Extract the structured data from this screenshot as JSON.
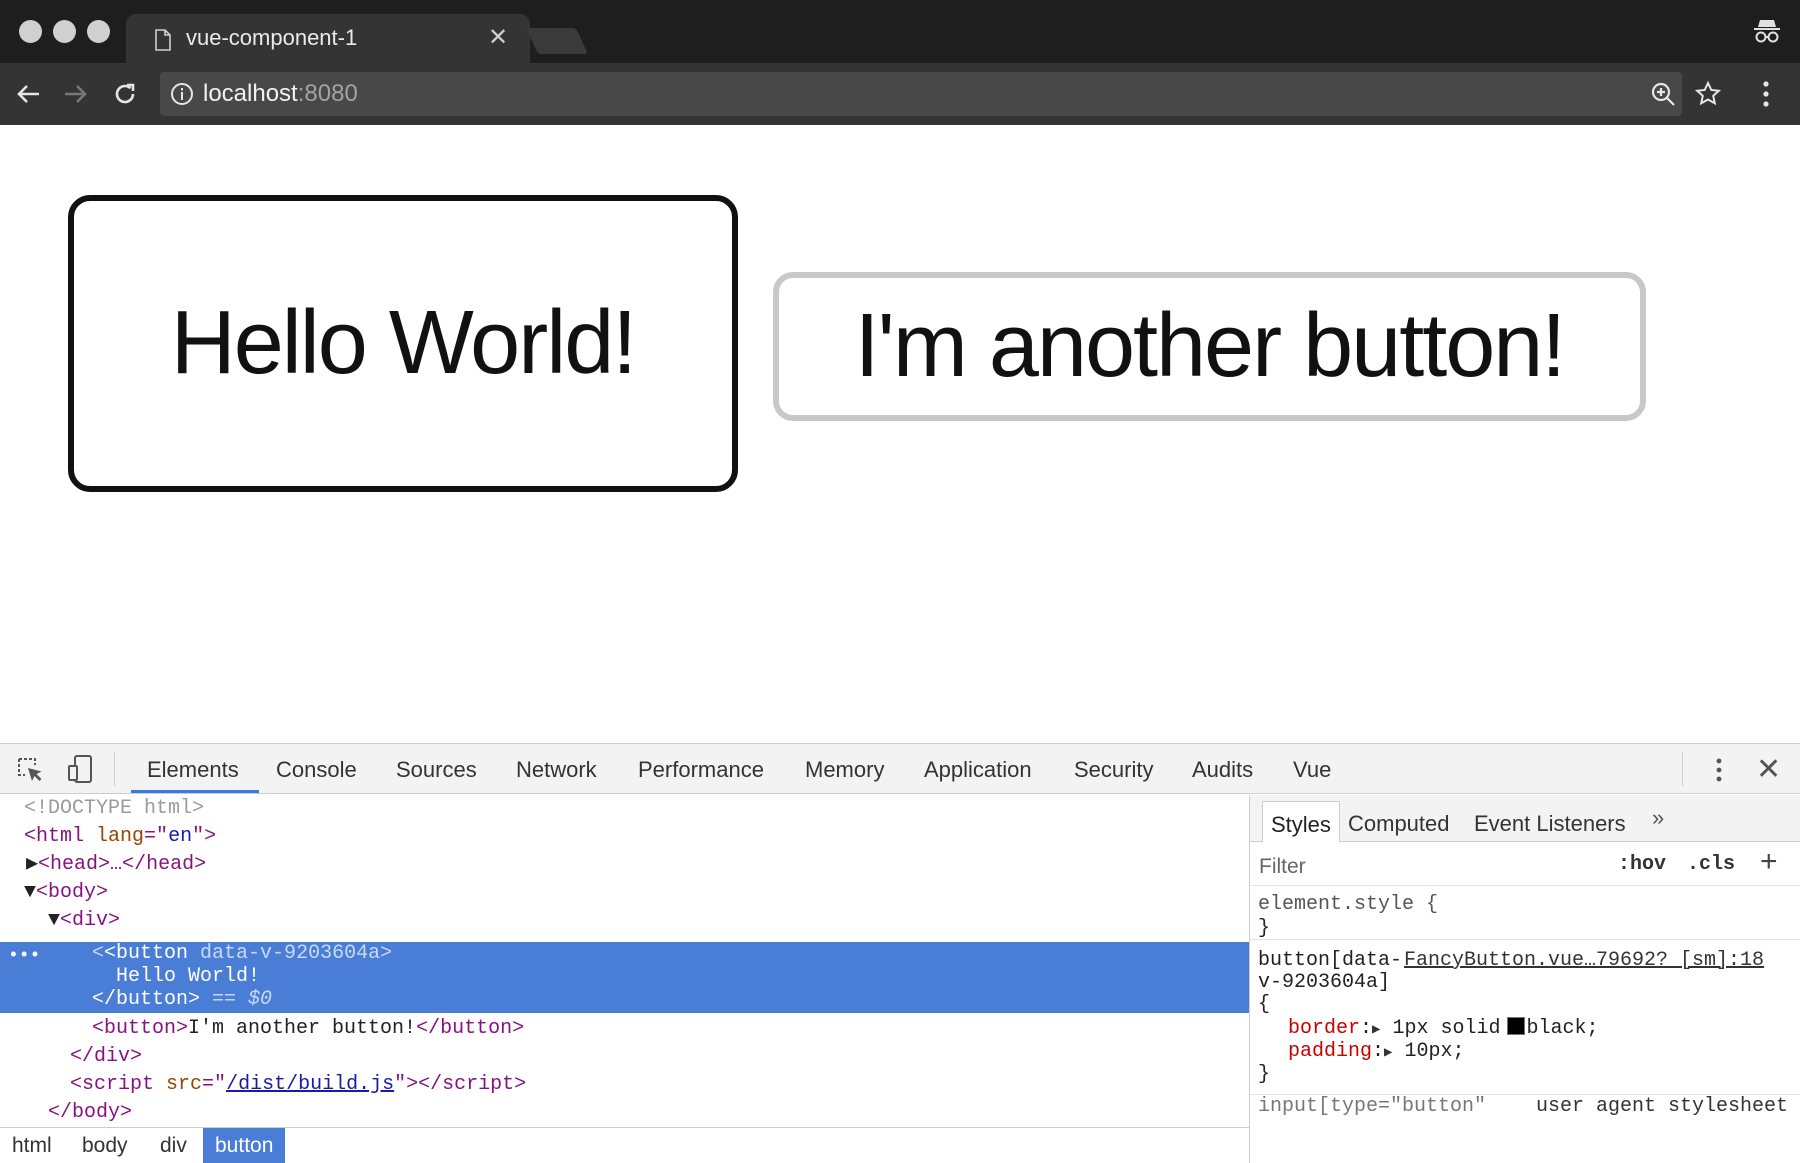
{
  "browser": {
    "tab_title": "vue-component-1",
    "url_host": "localhost",
    "url_port": ":8080"
  },
  "page": {
    "button1": "Hello World!",
    "button2": "I'm another button!"
  },
  "devtools": {
    "tabs": [
      "Elements",
      "Console",
      "Sources",
      "Network",
      "Performance",
      "Memory",
      "Application",
      "Security",
      "Audits",
      "Vue"
    ],
    "active_tab": "Elements",
    "dom": {
      "doctype": "<!DOCTYPE html>",
      "html_open_tag": "<html",
      "html_attr": "lang",
      "html_attr_value": "en",
      "head": "<head>…</head>",
      "body_open": "<body>",
      "div_open": "<div>",
      "sel_button_tag": "<button",
      "sel_button_attr": "data-v-9203604a",
      "sel_button_text": "Hello World!",
      "sel_button_close": "</button>",
      "sel_marker": "== $0",
      "button2_line": "I'm another button!",
      "div_close": "</div>",
      "script_src": "/dist/build.js",
      "body_close": "</body>"
    },
    "styles_pane": {
      "tabs": [
        "Styles",
        "Computed",
        "Event Listeners"
      ],
      "filter_placeholder": "Filter",
      "hov": ":hov",
      "cls": ".cls",
      "element_style": "element.style {",
      "rule_selector_1": "button[data-",
      "rule_selector_2": "v-9203604a]",
      "rule_source": "FancyButton.vue…79692? [sm]:18",
      "props": [
        {
          "name": "border",
          "value": "1px solid",
          "color_name": "black",
          "color": "#000000"
        },
        {
          "name": "padding",
          "value": "10px"
        }
      ],
      "ua_selector": "input[type=\"button\"",
      "ua_source": "user agent stylesheet"
    },
    "breadcrumbs": [
      "html",
      "body",
      "div",
      "button"
    ],
    "active_breadcrumb": "button"
  },
  "colors": {
    "accent": "#4a7dd6",
    "titlebar": "#1e1e1e",
    "toolbar": "#343434"
  }
}
